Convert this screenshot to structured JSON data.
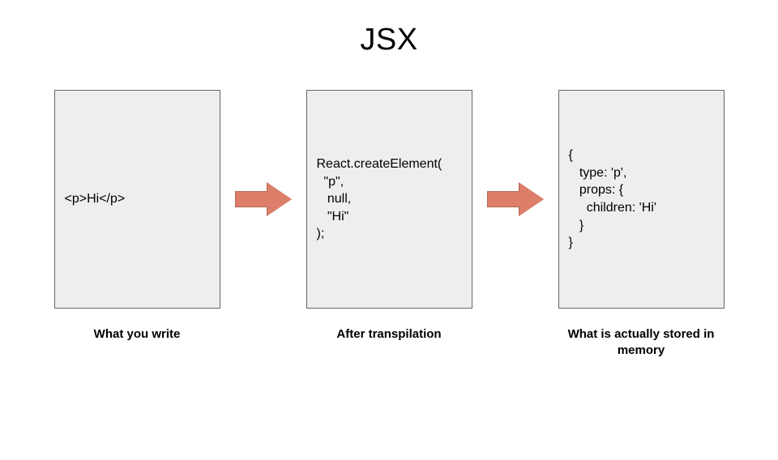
{
  "title": "JSX",
  "boxes": {
    "left": "<p>Hi</p>",
    "middle": "React.createElement(\n  \"p\",\n   null,\n   \"Hi\"\n);",
    "right": "{\n   type: 'p',\n   props: {\n     children: 'Hi'\n   }\n}"
  },
  "captions": {
    "left": "What you write",
    "middle": "After transpilation",
    "right": "What is actually stored in memory"
  },
  "arrow_color": "#dd7e6b"
}
